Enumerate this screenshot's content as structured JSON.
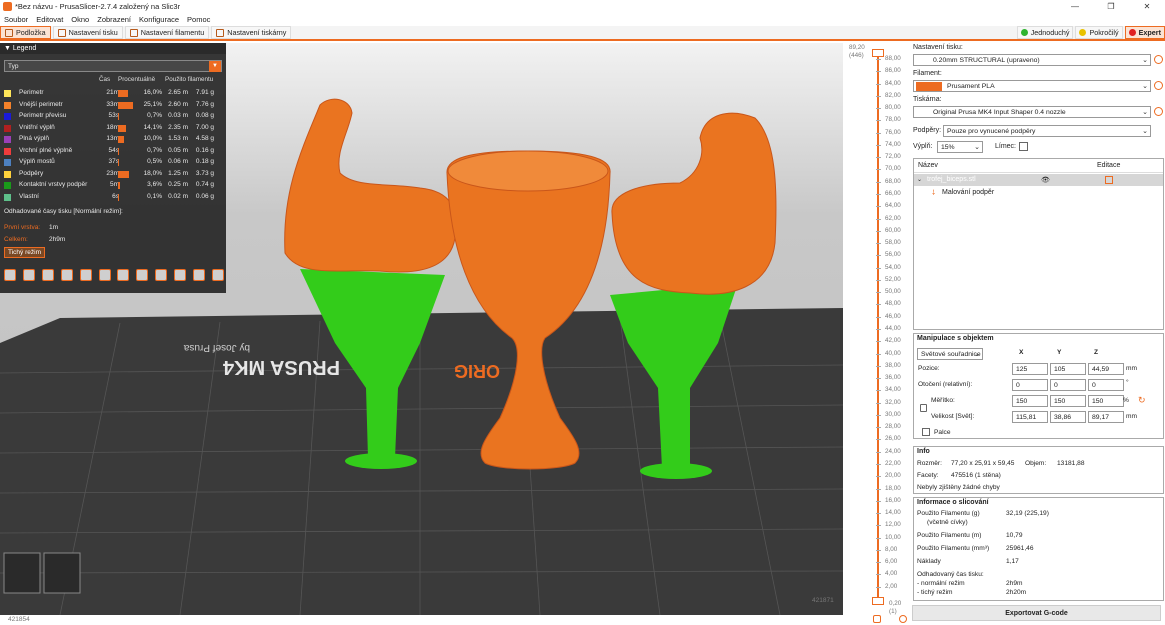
{
  "window": {
    "title": "*Bez názvu - PrusaSlicer-2.7.4 založený na Slic3r",
    "controls": [
      "—",
      "❐",
      "✕"
    ]
  },
  "menu": [
    "Soubor",
    "Editovat",
    "Okno",
    "Zobrazení",
    "Konfigurace",
    "Pomoc"
  ],
  "tabs": [
    {
      "label": "Podložka"
    },
    {
      "label": "Nastavení tisku"
    },
    {
      "label": "Nastavení filamentu"
    },
    {
      "label": "Nastavení tiskárny"
    }
  ],
  "modes": [
    {
      "label": "Jednoduchý",
      "color": "#2fb32f"
    },
    {
      "label": "Pokročilý",
      "color": "#e8c200"
    },
    {
      "label": "Expert",
      "color": "#e02020"
    }
  ],
  "legend": {
    "header": "Legend",
    "combo": "Typ",
    "cols": {
      "time": "Čas",
      "percent": "Procentuálně",
      "usage": "Použito filamentu"
    },
    "rows": [
      {
        "name": "Perimetr",
        "color": "#ffe65a",
        "time": "21m",
        "pct": "16,0%",
        "bar": 0.16,
        "m": "2.65 m",
        "g": "7.91 g"
      },
      {
        "name": "Vnější perimetr",
        "color": "#f5822a",
        "time": "33m",
        "pct": "25,1%",
        "bar": 0.251,
        "m": "2.60 m",
        "g": "7.76 g"
      },
      {
        "name": "Perimetr převisu",
        "color": "#1a1ad8",
        "time": "53s",
        "pct": "0,7%",
        "bar": 0.007,
        "m": "0.03 m",
        "g": "0.08 g"
      },
      {
        "name": "Vnitřní výplň",
        "color": "#b02020",
        "time": "18m",
        "pct": "14,1%",
        "bar": 0.141,
        "m": "2.35 m",
        "g": "7.00 g"
      },
      {
        "name": "Plná výplň",
        "color": "#9940b8",
        "time": "13m",
        "pct": "10,0%",
        "bar": 0.1,
        "m": "1.53 m",
        "g": "4.58 g"
      },
      {
        "name": "Vrchní plné výplně",
        "color": "#f03c3c",
        "time": "54s",
        "pct": "0,7%",
        "bar": 0.007,
        "m": "0.05 m",
        "g": "0.16 g"
      },
      {
        "name": "Výplň mostů",
        "color": "#4d80c0",
        "time": "37s",
        "pct": "0,5%",
        "bar": 0.005,
        "m": "0.06 m",
        "g": "0.18 g"
      },
      {
        "name": "Podpěry",
        "color": "#ffd23c",
        "time": "23m",
        "pct": "18,0%",
        "bar": 0.18,
        "m": "1.25 m",
        "g": "3.73 g"
      },
      {
        "name": "Kontaktní vrstvy podpěr",
        "color": "#1a9a1a",
        "time": "5m",
        "pct": "3,6%",
        "bar": 0.036,
        "m": "0.25 m",
        "g": "0.74 g"
      },
      {
        "name": "Vlastní",
        "color": "#5ec08a",
        "time": "6s",
        "pct": "0,1%",
        "bar": 0.001,
        "m": "0.02 m",
        "g": "0.06 g"
      }
    ],
    "estimate_title": "Odhadované časy tisku [Normální režim]:",
    "first_layer_k": "První vrstva:",
    "first_layer_v": "1m",
    "total_k": "Celkem:",
    "total_v": "2h9m",
    "silent_btn": "Tichý režim"
  },
  "viewport": {
    "bottom_left": "421854",
    "bottom_right": "421871",
    "plate_text": "PRUSA MK4",
    "plate_sub": "by Josef Prusa",
    "plate_orig": "ORIG"
  },
  "slider": {
    "top_value": "89,20",
    "top_layer": "(446)",
    "bottom_value": "0,20",
    "bottom_layer": "(1)",
    "ticks": [
      "88,00",
      "86,00",
      "84,00",
      "82,00",
      "80,00",
      "78,00",
      "76,00",
      "74,00",
      "72,00",
      "70,00",
      "68,00",
      "66,00",
      "64,00",
      "62,00",
      "60,00",
      "58,00",
      "56,00",
      "54,00",
      "52,00",
      "50,00",
      "48,00",
      "46,00",
      "44,00",
      "42,00",
      "40,00",
      "38,00",
      "36,00",
      "34,00",
      "32,00",
      "30,00",
      "28,00",
      "26,00",
      "24,00",
      "22,00",
      "20,00",
      "18,00",
      "16,00",
      "14,00",
      "12,00",
      "10,00",
      "8,00",
      "6,00",
      "4,00",
      "2,00"
    ]
  },
  "panel": {
    "print_k": "Nastavení tisku:",
    "print_v": "0.20mm STRUCTURAL (upraveno)",
    "filament_k": "Filament:",
    "filament_v": "Prusament PLA",
    "filament_color": "#ed6b21",
    "printer_k": "Tiskárna:",
    "printer_v": "Original Prusa MK4 Input Shaper 0.4 nozzle",
    "supports_k": "Podpěry:",
    "supports_v": "Pouze pro vynucené podpěry",
    "infill_k": "Výplň:",
    "infill_v": "15%",
    "brim_k": "Límec:",
    "obj_col_name": "Název",
    "obj_col_edit": "Editace",
    "obj_name": "trofej_biceps.stl",
    "obj_sub": "Malování podpěr",
    "manip_title": "Manipulace s objektem",
    "coords": "Světové souřadnice",
    "axis_x": "X",
    "axis_y": "Y",
    "axis_z": "Z",
    "pos_k": "Pozice:",
    "pos": [
      "125",
      "105",
      "44,59"
    ],
    "pos_u": "mm",
    "rot_k": "Otočení (relativní):",
    "rot": [
      "0",
      "0",
      "0"
    ],
    "rot_u": "°",
    "scale_k": "Měřítko:",
    "scale": [
      "150",
      "150",
      "150"
    ],
    "scale_u": "%",
    "size_k": "Velikost [Svět]:",
    "size": [
      "115,81",
      "38,86",
      "89,17"
    ],
    "size_u": "mm",
    "inch_k": "Palce",
    "info_title": "Info",
    "dims_k": "Rozměr:",
    "dims_v": "77,20 x 25,91 x 59,45",
    "vol_k": "Objem:",
    "vol_v": "13181,88",
    "facets_k": "Facety:",
    "facets_v": "475516 (1 stěna)",
    "errors": "Nebyly zjištěny žádné chyby",
    "slice_title": "Informace o slicování",
    "fil_g_k": "Použito Filamentu (g)",
    "fil_g_k2": "(včetně cívky)",
    "fil_g_v": "32,19 (225,19)",
    "fil_m_k": "Použito Filamentu (m)",
    "fil_m_v": "10,79",
    "fil_mm3_k": "Použito Filamentu (mm³)",
    "fil_mm3_v": "25961,46",
    "cost_k": "Náklady",
    "cost_v": "1,17",
    "est_k": "Odhadovaný čas tisku:",
    "normal_k": "- normální režim",
    "normal_v": "2h9m",
    "silent_k": "- tichý režim",
    "silent_v": "2h20m",
    "export": "Exportovat G-code"
  }
}
